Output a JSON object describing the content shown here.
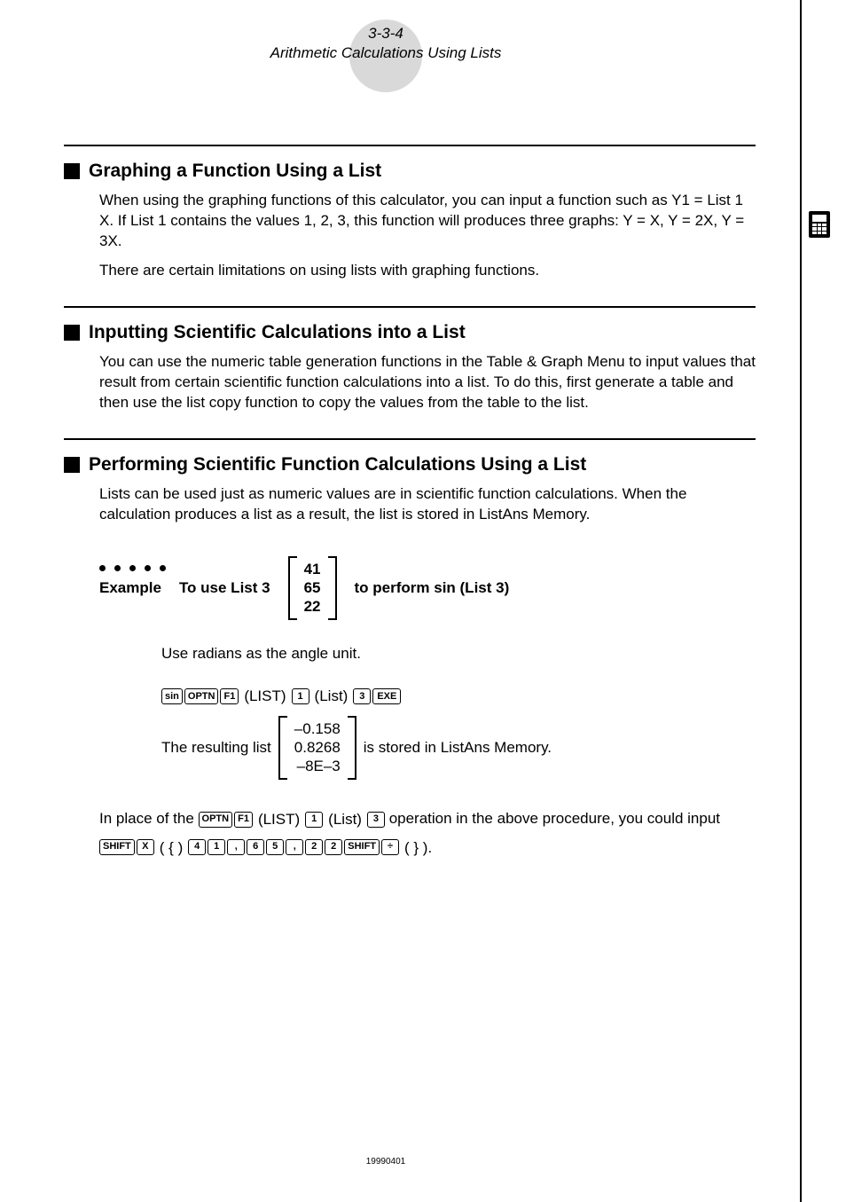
{
  "header": {
    "page_number": "3-3-4",
    "title": "Arithmetic Calculations Using Lists"
  },
  "sections": {
    "graphing": {
      "heading": "Graphing a Function Using a List",
      "p1": "When using the graphing functions of this calculator, you can input a function such as Y1 = List 1 X. If List 1 contains the values 1, 2, 3, this function will produces three graphs: Y = X, Y = 2X, Y = 3X.",
      "p2": "There are certain limitations on using lists with graphing functions."
    },
    "inputting": {
      "heading": "Inputting Scientific Calculations into a List",
      "p1": "You can use the numeric table generation functions in the Table & Graph Menu to input values that result from certain scientific function calculations into a list. To do this, first generate a table and then use the list copy function to copy the values from the table to the list."
    },
    "performing": {
      "heading": "Performing Scientific Function Calculations Using a List",
      "p1": "Lists can be used just as numeric values are in scientific function calculations. When the calculation produces a list as a result, the list is stored in ListAns Memory.",
      "example_label": "Example",
      "example_pre": "To use List 3",
      "example_matrix": [
        "41",
        "65",
        "22"
      ],
      "example_post": "to perform sin (List 3)",
      "note": "Use radians as the angle unit.",
      "keys": {
        "sin": "sin",
        "optn": "OPTN",
        "f1": "F1",
        "list_menu": "(LIST)",
        "k1": "1",
        "list_item": "(List)",
        "k3": "3",
        "exe": "EXE"
      },
      "result_pre": "The resulting list",
      "result_matrix": [
        "–0.158",
        "0.8268",
        "–8E–3"
      ],
      "result_post": " is stored in ListAns Memory.",
      "alt_pre": "In place of the ",
      "alt_mid": " operation in the above procedure, you could input",
      "alt_keys": {
        "shift": "SHIFT",
        "x": "X",
        "lbrace": "( { )",
        "k4": "4",
        "k1": "1",
        "comma": ",",
        "k6": "6",
        "k5": "5",
        "k2a": "2",
        "k2b": "2",
        "div": "÷",
        "rbrace": "( } )."
      }
    }
  },
  "footer": {
    "code": "19990401"
  }
}
